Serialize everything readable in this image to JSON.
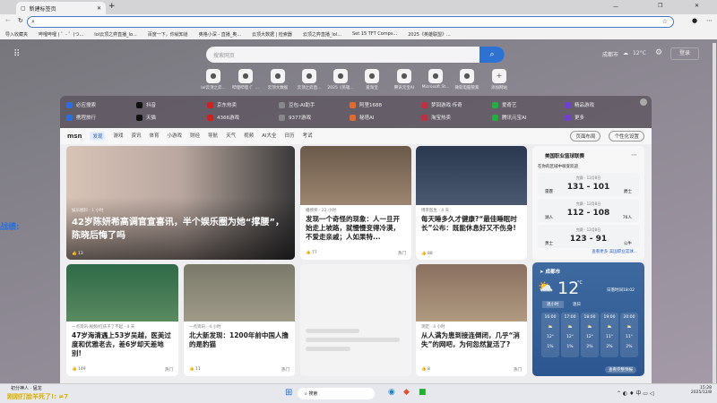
{
  "browser": {
    "tab_title": "新建标签页",
    "new_tab": "+",
    "window_controls": [
      "—",
      "❐",
      "✕"
    ],
    "bookmarks": [
      "导入收藏夹",
      "哔哩哔哩 ( ゜- ゜)つ...",
      "lol云顶之弈直播_lo...",
      "百度一下，你就知道",
      "奥格小深 - 直播_奥...",
      "云顶大数据 | 检索器",
      "云顶之弈直播_lol...",
      "Set 15 TFT Comps...",
      "2025《英雄联盟》..."
    ]
  },
  "header": {
    "search_placeholder": "搜索网页",
    "city": "成都市",
    "temp": "12°C",
    "login": "登录"
  },
  "quick_links": [
    "lol云顶之弈...",
    "哔哩哔哩 (゜...",
    "云顶大数据",
    "云顶之弈直...",
    "2025《英雄...",
    "爱淘宝",
    "腾讯元宝AI",
    "Microsoft St...",
    "微软电脑管家",
    "添加网站"
  ],
  "top_links": [
    [
      "必应搜索",
      "抖音",
      "京东热卖",
      "豆包-AI助手",
      "阿里1688",
      "梦回游戏·传奇",
      "爱奇艺",
      "精品游戏"
    ],
    [
      "携程旅行",
      "天猫",
      "4366游戏",
      "9377游戏",
      "秘塔AI",
      "淘宝热卖",
      "腾讯元宝AI",
      "更多"
    ]
  ],
  "msn": {
    "logo": "msn",
    "tabs": [
      "发现",
      "游戏",
      "资讯",
      "体育",
      "小游戏",
      "财经",
      "导航",
      "天气",
      "视频",
      "AI大全",
      "日历",
      "考试"
    ],
    "layout_btn": "页面布局",
    "personalize_btn": "个性化设置"
  },
  "cards": [
    {
      "source": "娱乐圈料 · 1 小时",
      "title": "42岁陈妍希高调官宣喜讯，半个娱乐圈为她“撑腰”，陈晓后悔了吗",
      "likes": "13"
    },
    {
      "source": "播感师 · 22 小时",
      "title": "发现一个奇怪的现象：人一旦开始走上坡路，就慢慢变得冷漠，不爱走亲戚；人如果特...",
      "likes": "77",
      "tag": "热门"
    },
    {
      "source": "博禾医生 · 4 天",
      "title": "每天睡多久才健康?“最佳睡眠时长”公布：既能休息好又不伤身!",
      "likes": "88"
    },
    {
      "source": "一点资讯-视频/红孩子了不起 · 4 天",
      "title": "47岁海清遇上53岁吴越，医美过度和优雅老去，差6岁却天差地别!",
      "likes": "149",
      "tag": "热门"
    },
    {
      "source": "一点资讯 · 4 小时",
      "title": "北大新发现：1200年前中国人撸的是豹猫",
      "likes": "11",
      "tag": "热门"
    },
    {
      "source": "测定 · 4 小时",
      "title": "从人满为患到接连倒闭，几乎“消失”的网吧，为何忽然复活了?",
      "likes": "8",
      "tag": "热门"
    }
  ],
  "nba": {
    "title": "美国职业篮球联赛",
    "subtitle": "在你的区域中很受欢迎",
    "more": "查看更多 美国职业篮球...",
    "games": [
      {
        "date": "完赛 · 12月8日",
        "home": "雷霆",
        "away": "爵士",
        "score": "131 - 101"
      },
      {
        "date": "完赛 · 12月8日",
        "home": "湖人",
        "away": "76人",
        "score": "112 - 108"
      },
      {
        "date": "完赛 · 12月8日",
        "home": "勇士",
        "away": "公牛",
        "score": "123 - 91"
      }
    ]
  },
  "weather": {
    "city": "成都市",
    "temp": "12",
    "unit": "°C",
    "sunset": "日落时间18:02",
    "tabs": [
      "逐小时",
      "逐日"
    ],
    "more": "查看完整预报",
    "hours": [
      {
        "t": "16:00",
        "temp": "12°",
        "rain": "1%"
      },
      {
        "t": "17:00",
        "temp": "12°",
        "rain": "1%"
      },
      {
        "t": "18:00",
        "temp": "12°",
        "rain": "2%"
      },
      {
        "t": "19:00",
        "temp": "11°",
        "rain": "2%"
      },
      {
        "t": "20:00",
        "temp": "11°",
        "rain": "2%"
      }
    ]
  },
  "overlay": {
    "left_text": "战绩:",
    "bottom_user": "初分神人 · 猛龙",
    "bottom_text": "刚刚打脸羊死了!: ≠7"
  },
  "taskbar": {
    "search": "搜索",
    "time": "15:28",
    "date": "2025/12/8"
  }
}
